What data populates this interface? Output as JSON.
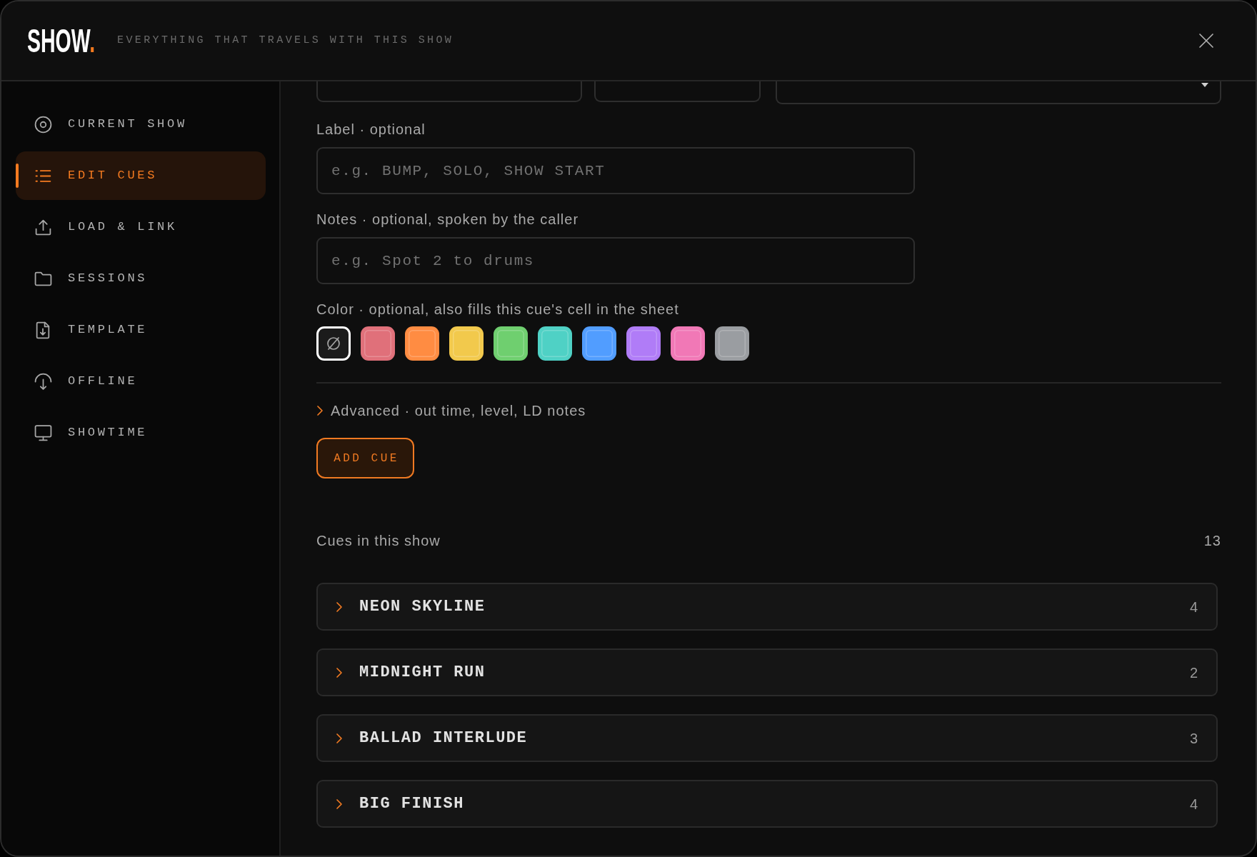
{
  "header": {
    "logo": "SHOW",
    "logo_dot": ".",
    "tagline": "EVERYTHING THAT TRAVELS WITH THIS SHOW"
  },
  "sidebar": {
    "items": [
      {
        "label": "CURRENT SHOW",
        "selected": false
      },
      {
        "label": "EDIT CUES",
        "selected": true
      },
      {
        "label": "LOAD & LINK",
        "selected": false
      },
      {
        "label": "SESSIONS",
        "selected": false
      },
      {
        "label": "TEMPLATE",
        "selected": false
      },
      {
        "label": "OFFLINE",
        "selected": false
      },
      {
        "label": "SHOWTIME",
        "selected": false
      }
    ]
  },
  "form": {
    "top_fields": [
      {
        "kind": "input"
      },
      {
        "kind": "input"
      },
      {
        "kind": "select"
      }
    ],
    "label_field": {
      "label": "Label · optional",
      "placeholder": "e.g. BUMP, SOLO, SHOW START"
    },
    "notes_field": {
      "label": "Notes · optional, spoken by the caller",
      "placeholder": "e.g. Spot 2 to drums"
    },
    "color_field": {
      "label": "Color · optional, also fills this cue's cell in the sheet",
      "swatches": [
        {
          "kind": "none",
          "selected": true
        },
        {
          "kind": "color",
          "color": "#e0707a",
          "selected": false
        },
        {
          "kind": "color",
          "color": "#ff8c42",
          "selected": false
        },
        {
          "kind": "color",
          "color": "#f2c94c",
          "selected": false
        },
        {
          "kind": "color",
          "color": "#6fcf6f",
          "selected": false
        },
        {
          "kind": "color",
          "color": "#4fd1c5",
          "selected": false
        },
        {
          "kind": "color",
          "color": "#519dff",
          "selected": false
        },
        {
          "kind": "color",
          "color": "#b07cf7",
          "selected": false
        },
        {
          "kind": "color",
          "color": "#f178b6",
          "selected": false
        },
        {
          "kind": "color",
          "color": "#9a9da1",
          "selected": false
        }
      ]
    },
    "advanced": {
      "label": "Advanced · out time, level, LD notes",
      "expanded": false
    },
    "add_button": "ADD CUE"
  },
  "cues": {
    "title": "Cues in this show",
    "count": "13",
    "groups": [
      {
        "name": "NEON SKYLINE",
        "count": "4",
        "expanded": false
      },
      {
        "name": "MIDNIGHT RUN",
        "count": "2",
        "expanded": false
      },
      {
        "name": "BALLAD INTERLUDE",
        "count": "3",
        "expanded": false
      },
      {
        "name": "BIG FINISH",
        "count": "4",
        "expanded": false
      }
    ]
  }
}
